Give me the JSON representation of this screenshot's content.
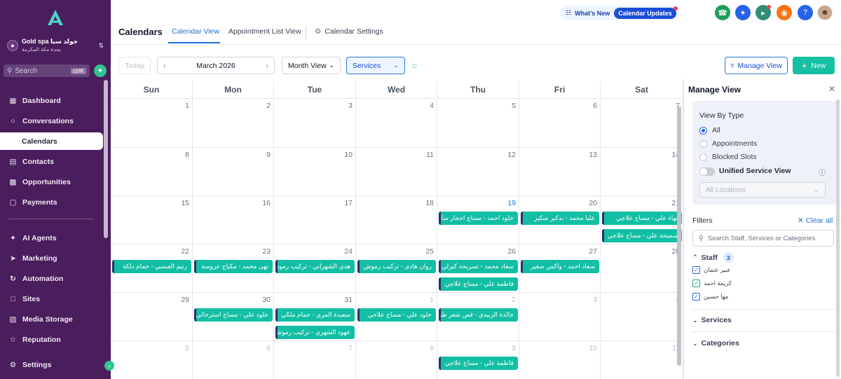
{
  "sidebar": {
    "location_name": "Gold spa جولد سبا",
    "location_sub": "بجدة مكة المكرمة",
    "search_placeholder": "Search",
    "search_shortcut": "ctrlK",
    "nav": [
      {
        "label": "Dashboard",
        "icon": "dashboard-icon"
      },
      {
        "label": "Conversations",
        "icon": "chat-icon"
      },
      {
        "label": "Calendars",
        "icon": "calendar-icon"
      },
      {
        "label": "Contacts",
        "icon": "contacts-icon"
      },
      {
        "label": "Opportunities",
        "icon": "opportunities-icon"
      },
      {
        "label": "Payments",
        "icon": "payments-icon"
      },
      {
        "label": "AI Agents",
        "icon": "sparkle-icon"
      },
      {
        "label": "Marketing",
        "icon": "send-icon"
      },
      {
        "label": "Automation",
        "icon": "automation-icon"
      },
      {
        "label": "Sites",
        "icon": "sites-icon"
      },
      {
        "label": "Media Storage",
        "icon": "image-icon"
      },
      {
        "label": "Reputation",
        "icon": "star-icon"
      },
      {
        "label": "Settings",
        "icon": "gear-icon"
      }
    ],
    "active": "Calendars"
  },
  "topbar": {
    "whats_new": "What's New",
    "badge": "Calendar Updates",
    "colors": {
      "phone": "#1e9e5a",
      "megaphone_blue": "#2563eb",
      "megaphone_green": "#2f8d76",
      "bell": "#f97316",
      "help": "#2563eb"
    }
  },
  "subnav": {
    "title": "Calendars",
    "tabs": [
      "Calendar View",
      "Appointment List View",
      "Calendar Settings"
    ],
    "active_tab": "Calendar View"
  },
  "toolbar": {
    "today": "Today",
    "month": "March 2026",
    "view_select": "Month View",
    "filter_select": "Services",
    "manage_view": "Manage View",
    "new": "New"
  },
  "calendar": {
    "weekdays": [
      "Sun",
      "Mon",
      "Tue",
      "Wed",
      "Thu",
      "Fri",
      "Sat"
    ],
    "weeks": [
      [
        "1",
        "2",
        "3",
        "4",
        "5",
        "6",
        "7"
      ],
      [
        "8",
        "9",
        "10",
        "11",
        "12",
        "13",
        "14"
      ],
      [
        "15",
        "16",
        "17",
        "18",
        "19",
        "20",
        "21"
      ],
      [
        "22",
        "23",
        "24",
        "25",
        "26",
        "27",
        "28"
      ],
      [
        "29",
        "30",
        "31",
        "1",
        "2",
        "3",
        "4"
      ],
      [
        "5",
        "6",
        "7",
        "8",
        "9",
        "10",
        "11"
      ]
    ],
    "today_cell": [
      2,
      4
    ],
    "muted_cells": [
      [
        4,
        3
      ],
      [
        4,
        4
      ],
      [
        4,
        5
      ],
      [
        4,
        6
      ],
      [
        5,
        0
      ],
      [
        5,
        1
      ],
      [
        5,
        2
      ],
      [
        5,
        3
      ],
      [
        5,
        4
      ],
      [
        5,
        5
      ],
      [
        5,
        6
      ]
    ],
    "events": [
      {
        "week": 2,
        "day": 4,
        "slot": 0,
        "text": "خلود احمد - مساج احجار ساخنة"
      },
      {
        "week": 2,
        "day": 5,
        "slot": 0,
        "text": "عليا محمد - بدكير منكير"
      },
      {
        "week": 2,
        "day": 6,
        "slot": 0,
        "text": "نهاء علي - مساج علاجي"
      },
      {
        "week": 2,
        "day": 6,
        "slot": 1,
        "text": "سميحة علي - مساج علاجي"
      },
      {
        "week": 3,
        "day": 0,
        "slot": 0,
        "text": "رنيم العبسي - حمام دلكة"
      },
      {
        "week": 3,
        "day": 1,
        "slot": 0,
        "text": "نهى محمد - مكياج عروسة"
      },
      {
        "week": 3,
        "day": 2,
        "slot": 0,
        "text": "هدى الشهراني - تركيب رموش"
      },
      {
        "week": 3,
        "day": 3,
        "slot": 0,
        "text": "روان هادي - تركيب رموش"
      },
      {
        "week": 3,
        "day": 4,
        "slot": 0,
        "text": "سعاد محمد - تسريحة كيرلي"
      },
      {
        "week": 3,
        "day": 4,
        "slot": 1,
        "text": "فاطمة علي - مساج علاجي"
      },
      {
        "week": 3,
        "day": 5,
        "slot": 0,
        "text": "سعاد احمد - واكس صغير"
      },
      {
        "week": 4,
        "day": 1,
        "slot": 0,
        "text": "خلود علي - مساج استرخائي"
      },
      {
        "week": 4,
        "day": 2,
        "slot": 0,
        "text": "سعيدة المري - حمام ملكي"
      },
      {
        "week": 4,
        "day": 2,
        "slot": 1,
        "text": "عهود الشهري - تركيب رموش"
      },
      {
        "week": 4,
        "day": 3,
        "slot": 0,
        "text": "خلود علي - مساج علاجي"
      },
      {
        "week": 4,
        "day": 4,
        "slot": 0,
        "text": "خالدة الزبيدي - قص شعر طويل"
      },
      {
        "week": 5,
        "day": 4,
        "slot": 0,
        "text": "فاطمة علي - مساج علاجي"
      }
    ]
  },
  "panel": {
    "title": "Manage View",
    "view_by_type": "View By Type",
    "types": [
      "All",
      "Appointments",
      "Blocked Slots"
    ],
    "selected_type": "All",
    "unified": "Unified Service View",
    "locations_placeholder": "All Locations",
    "filters": "Filters",
    "clear_all": "Clear all",
    "search_placeholder": "Search Staff, Services or Categories",
    "staff_label": "Staff",
    "staff_count": "3",
    "staff": [
      "عبير عثمان",
      "كريمة احمد",
      "مها حسين"
    ],
    "services": "Services",
    "categories": "Categories"
  }
}
